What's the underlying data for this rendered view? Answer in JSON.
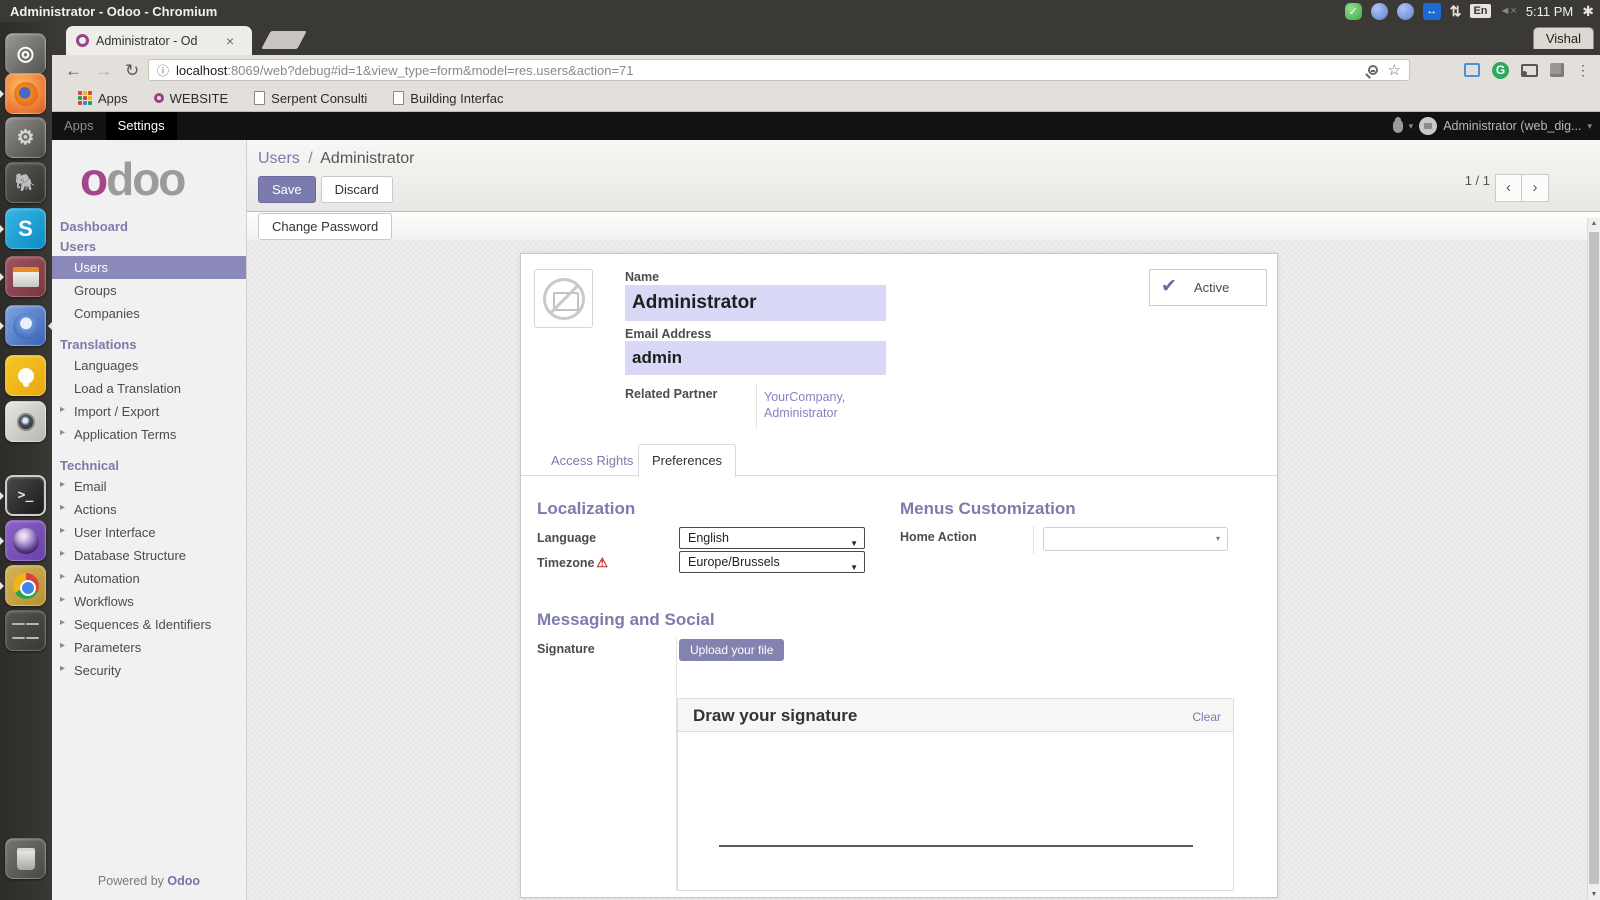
{
  "desktop": {
    "window_title": "Administrator - Odoo - Chromium",
    "tray": {
      "keyboard_layout": "En",
      "time": "5:11 PM",
      "icons": [
        "skype-online-icon",
        "chromium-icon",
        "chromium-icon",
        "teamviewer-icon",
        "network-arrows-icon",
        "volume-muted-icon",
        "session-gear-icon"
      ]
    },
    "launcher_items": [
      "ubuntu-dash",
      "firefox",
      "tweak-tool",
      "postgresql",
      "skype",
      "file-archiver",
      "chromium",
      "google-keep",
      "camera-app",
      "terminal",
      "eclipse",
      "chrome",
      "workspace-switcher",
      "trash"
    ]
  },
  "browser": {
    "profile_name": "Vishal",
    "tab_title": "Administrator - Od",
    "close_glyph": "×",
    "url_host": "localhost",
    "url_rest": ":8069/web?debug#id=1&view_type=form&model=res.users&action=71",
    "back_glyph": "←",
    "forward_glyph": "→",
    "reload_glyph": "↻",
    "info_glyph": "ⓘ",
    "star_glyph": "☆",
    "kebab_glyph": "⋮",
    "bookmarks": [
      {
        "label": "Apps"
      },
      {
        "label": "WEBSITE"
      },
      {
        "label": "Serpent Consulti"
      },
      {
        "label": "Building Interfac"
      }
    ]
  },
  "odoo": {
    "nav": {
      "apps": "Apps",
      "settings": "Settings",
      "user": "Administrator (web_dig...",
      "caret": "▾"
    },
    "sidebar": {
      "logo_first": "o",
      "logo_rest": "doo",
      "items": [
        {
          "label": "Dashboard",
          "type": "heading"
        },
        {
          "label": "Users",
          "type": "heading"
        },
        {
          "label": "Users",
          "selected": true
        },
        {
          "label": "Groups"
        },
        {
          "label": "Companies"
        },
        {
          "label": "Translations",
          "type": "heading"
        },
        {
          "label": "Languages"
        },
        {
          "label": "Load a Translation"
        },
        {
          "label": "Import / Export",
          "arrow": true
        },
        {
          "label": "Application Terms",
          "arrow": true
        },
        {
          "label": "Technical",
          "type": "heading"
        },
        {
          "label": "Email",
          "arrow": true
        },
        {
          "label": "Actions",
          "arrow": true
        },
        {
          "label": "User Interface",
          "arrow": true
        },
        {
          "label": "Database Structure",
          "arrow": true
        },
        {
          "label": "Automation",
          "arrow": true
        },
        {
          "label": "Workflows",
          "arrow": true
        },
        {
          "label": "Sequences & Identifiers",
          "arrow": true
        },
        {
          "label": "Parameters",
          "arrow": true
        },
        {
          "label": "Security",
          "arrow": true
        }
      ],
      "arrow_glyph": "▸",
      "footer_prefix": "Powered by",
      "footer_brand": "Odoo"
    },
    "control_panel": {
      "breadcrumb_parent": "Users",
      "breadcrumb_sep": "/",
      "breadcrumb_current": "Administrator",
      "save": "Save",
      "discard": "Discard",
      "change_password": "Change Password",
      "pager": "1 / 1",
      "prev_glyph": "‹",
      "next_glyph": "›"
    },
    "form": {
      "name_label": "Name",
      "name_value": "Administrator",
      "email_label": "Email Address",
      "email_value": "admin",
      "related_partner_label": "Related Partner",
      "related_partner_value": "YourCompany, Administrator",
      "active_label": "Active",
      "active_check_glyph": "✔",
      "tabs": [
        {
          "label": "Access Rights"
        },
        {
          "label": "Preferences",
          "active": true
        }
      ],
      "localization": {
        "title": "Localization",
        "language_label": "Language",
        "language_value": "English",
        "timezone_label": "Timezone",
        "timezone_warning_glyph": "⚠",
        "timezone_value": "Europe/Brussels",
        "select_caret": "▼"
      },
      "menus": {
        "title": "Menus Customization",
        "home_action_label": "Home Action",
        "home_action_value": "",
        "combo_caret": "▾"
      },
      "messaging": {
        "title": "Messaging and Social",
        "signature_label": "Signature",
        "upload_button": "Upload your file",
        "draw_title": "Draw your signature",
        "clear_link": "Clear"
      }
    },
    "colors": {
      "accent": "#7C7BAD",
      "selected_menu_bg": "#8A89BA",
      "input_bg": "#D9D9F7",
      "warning_red": "#C9302C",
      "brand_magenta": "#A3478A"
    }
  }
}
